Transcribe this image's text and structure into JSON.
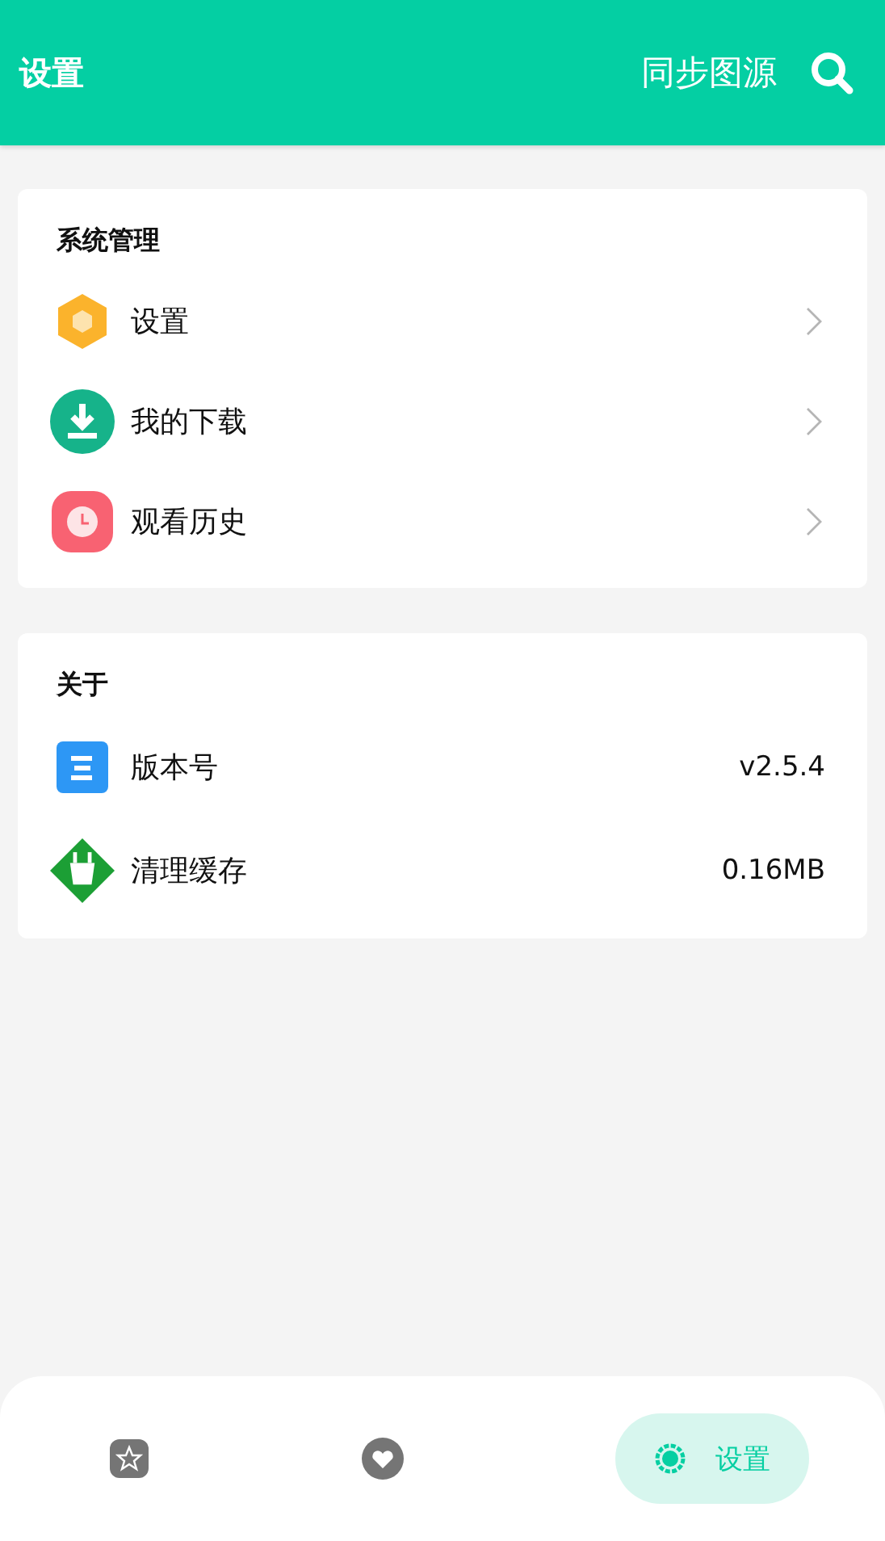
{
  "header": {
    "title": "设置",
    "action": "同步图源"
  },
  "sections": [
    {
      "title": "系统管理",
      "items": [
        {
          "label": "设置",
          "kind": "link"
        },
        {
          "label": "我的下载",
          "kind": "link"
        },
        {
          "label": "观看历史",
          "kind": "link"
        }
      ]
    },
    {
      "title": "关于",
      "items": [
        {
          "label": "版本号",
          "kind": "value",
          "value": "v2.5.4"
        },
        {
          "label": "清理缓存",
          "kind": "value",
          "value": "0.16MB"
        }
      ]
    }
  ],
  "nav": [
    {
      "selected": false
    },
    {
      "selected": false
    },
    {
      "label": "设置",
      "selected": true
    }
  ]
}
